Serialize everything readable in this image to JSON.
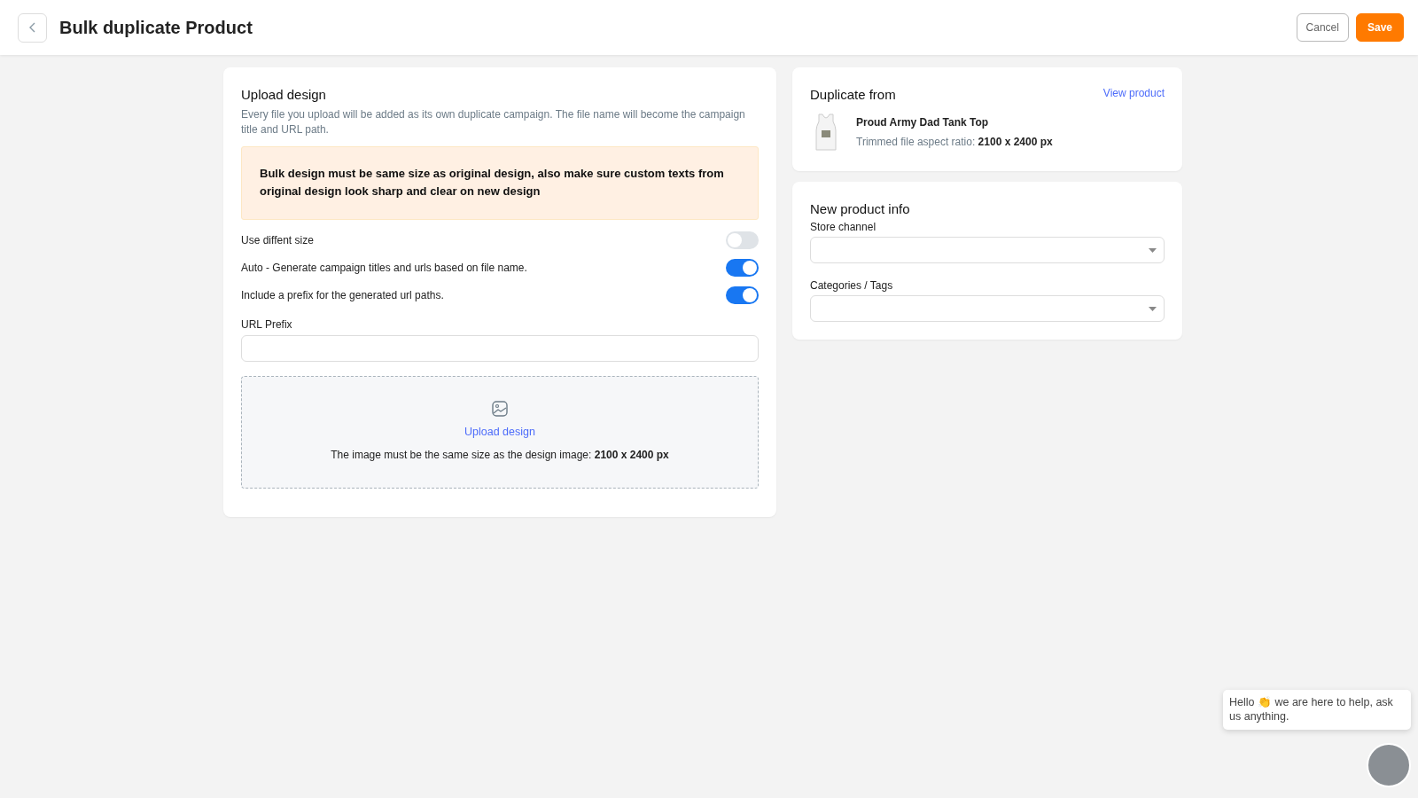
{
  "header": {
    "title": "Bulk duplicate Product",
    "buttons": [
      {
        "label": "Cancel",
        "kind": "outline"
      },
      {
        "label": "Save",
        "kind": "primary"
      }
    ]
  },
  "upload_card": {
    "title": "Upload design",
    "description": "Every file you upload will be added as its own duplicate campaign. The file name will become the campaign title and URL path.",
    "warning": "Bulk design must be same size as original design, also make sure custom texts from original design look sharp and clear on new design",
    "toggles": [
      {
        "label": "Use diffent size",
        "on": false
      },
      {
        "label": "Auto - Generate campaign titles and urls based on file name.",
        "on": true
      },
      {
        "label": "Include a prefix for the generated url paths.",
        "on": true
      }
    ],
    "url_prefix": {
      "label": "URL Prefix"
    },
    "dropzone": {
      "link": "Upload design",
      "hint": "The image must be the same size as the design image: **2100 x 2400 px**"
    }
  },
  "duplicate_from": {
    "title": "Duplicate from",
    "link": "View product",
    "product_name": "Proud Army Dad Tank Top",
    "ratio_label": "Trimmed file aspect ratio:",
    "ratio_value": "2100 x 2400 px"
  },
  "new_product_info": {
    "title": "New product info",
    "fields": [
      {
        "label": "Store channel"
      },
      {
        "label": "Categories / Tags"
      }
    ]
  },
  "chat": {
    "message": "Hello 👏 we are here to help, ask us anything."
  }
}
